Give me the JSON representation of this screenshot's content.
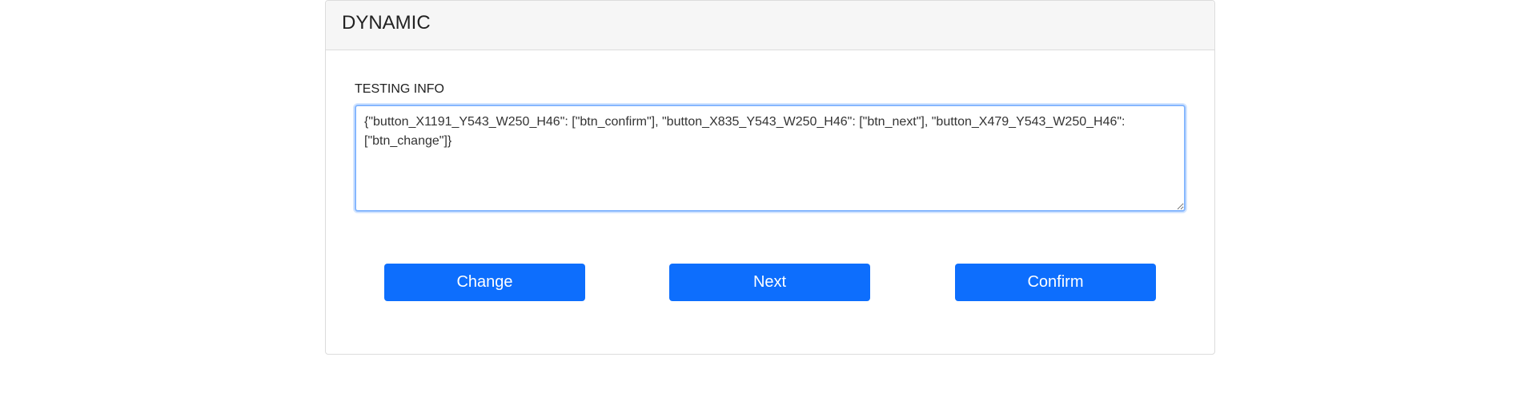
{
  "card": {
    "title": "DYNAMIC"
  },
  "form": {
    "label": "TESTING INFO",
    "value": "{\"button_X1191_Y543_W250_H46\": [\"btn_confirm\"], \"button_X835_Y543_W250_H46\": [\"btn_next\"], \"button_X479_Y543_W250_H46\": [\"btn_change\"]}"
  },
  "buttons": {
    "change": "Change",
    "next": "Next",
    "confirm": "Confirm"
  },
  "colors": {
    "primary": "#0d6efd",
    "header_bg": "#f6f6f6",
    "focus_border": "#86b7fe"
  }
}
